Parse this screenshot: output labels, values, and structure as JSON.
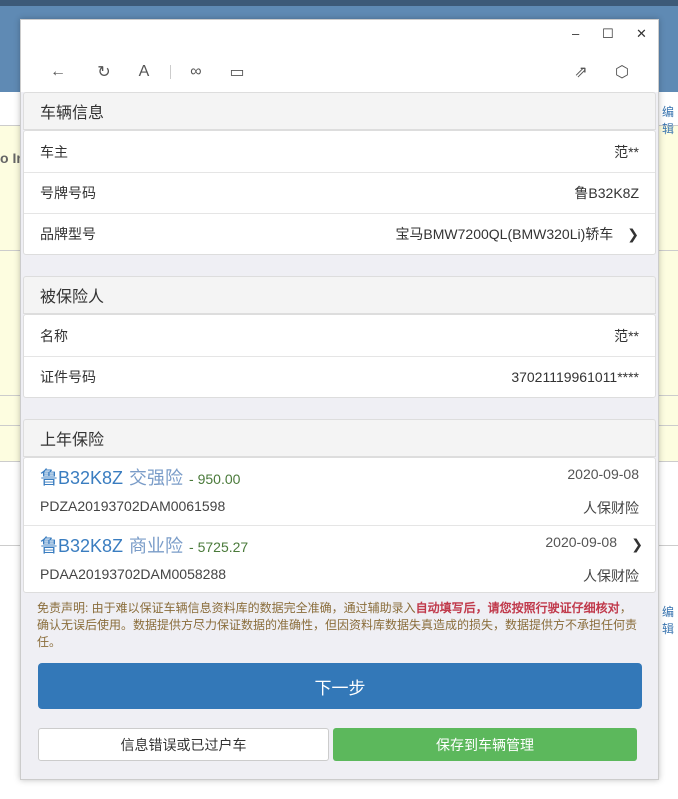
{
  "background": {
    "left_text": "o In",
    "edit_label": "编辑"
  },
  "window": {
    "minimize": "–",
    "maximize": "☐",
    "close": "✕"
  },
  "toolbar": {
    "back": "←",
    "refresh": "↻",
    "font": "A",
    "link": "∞",
    "window": "▭",
    "share": "⇗",
    "cube": "⬡"
  },
  "vehicle": {
    "title": "车辆信息",
    "rows": [
      {
        "label": "车主",
        "value": "范**"
      },
      {
        "label": "号牌号码",
        "value": "鲁B32K8Z"
      },
      {
        "label": "品牌型号",
        "value": "宝马BMW7200QL(BMW320Li)轿车"
      }
    ]
  },
  "insured": {
    "title": "被保险人",
    "rows": [
      {
        "label": "名称",
        "value": "范**"
      },
      {
        "label": "证件号码",
        "value": "37021119961011****"
      }
    ]
  },
  "last_year": {
    "title": "上年保险",
    "policies": [
      {
        "plate": "鲁B32K8Z",
        "type": "交强险",
        "amount": "- 950.00",
        "date": "2020-09-08",
        "number": "PDZA20193702DAM0061598",
        "company": "人保财险"
      },
      {
        "plate": "鲁B32K8Z",
        "type": "商业险",
        "amount": "- 5725.27",
        "date": "2020-09-08",
        "number": "PDAA20193702DAM0058288",
        "company": "人保财险"
      }
    ]
  },
  "disclaimer": {
    "prefix": "免责声明: 由于难以保证车辆信息资料库的数据完全准确，通过辅助录入",
    "highlight": "自动填写后，请您按照行驶证仔细核对",
    "suffix": "，确认无误后使用。数据提供方尽力保证数据的准确性，但因资料库数据失真造成的损失，数据提供方不承担任何责任。"
  },
  "buttons": {
    "next": "下一步",
    "error": "信息错误或已过户车",
    "save": "保存到车辆管理"
  }
}
